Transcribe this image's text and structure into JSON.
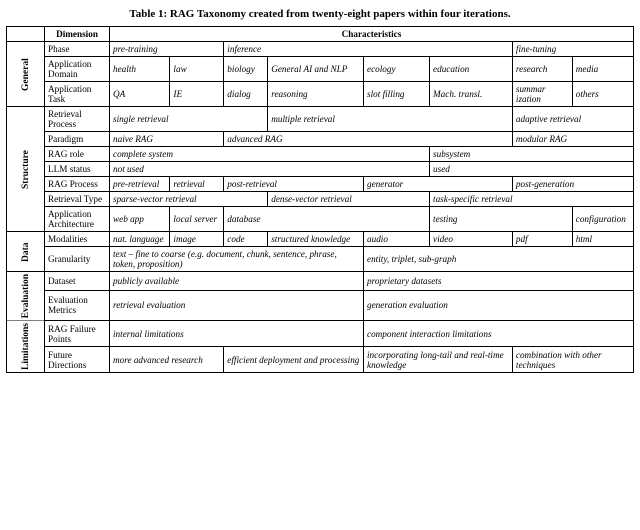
{
  "title": "Table 1: RAG Taxonomy created from twenty-eight papers within four iterations.",
  "header": {
    "dim_label": "Dimension",
    "char_label": "Characteristics"
  },
  "sections": [
    {
      "group": "General",
      "rows": [
        {
          "label": "Phase",
          "cells": [
            {
              "text": "pre-training",
              "italic": true,
              "colspan": 2
            },
            {
              "text": "inference",
              "italic": true,
              "colspan": 4
            },
            {
              "text": "fine-tuning",
              "italic": true,
              "colspan": 2
            }
          ]
        },
        {
          "label": "Application Domain",
          "cells": [
            {
              "text": "health",
              "italic": true
            },
            {
              "text": "law",
              "italic": true
            },
            {
              "text": "biology",
              "italic": true
            },
            {
              "text": "General AI and NLP",
              "italic": true
            },
            {
              "text": "ecology",
              "italic": true
            },
            {
              "text": "education",
              "italic": true
            },
            {
              "text": "research",
              "italic": true
            },
            {
              "text": "media",
              "italic": true
            }
          ]
        },
        {
          "label": "Application Task",
          "cells": [
            {
              "text": "QA",
              "italic": true
            },
            {
              "text": "IE",
              "italic": true
            },
            {
              "text": "dialog",
              "italic": true
            },
            {
              "text": "reasoning",
              "italic": true
            },
            {
              "text": "slot filling",
              "italic": true
            },
            {
              "text": "Mach. transl.",
              "italic": true
            },
            {
              "text": "summar ization",
              "italic": true
            },
            {
              "text": "others",
              "italic": true
            }
          ]
        }
      ]
    },
    {
      "group": "Structure",
      "rows": [
        {
          "label": "Retrieval Process",
          "cells": [
            {
              "text": "single retrieval",
              "italic": true,
              "colspan": 3
            },
            {
              "text": "multiple retrieval",
              "italic": true,
              "colspan": 3
            },
            {
              "text": "adaptive retrieval",
              "italic": true,
              "colspan": 2
            }
          ]
        },
        {
          "label": "Paradigm",
          "cells": [
            {
              "text": "naive RAG",
              "italic": true,
              "colspan": 2
            },
            {
              "text": "advanced RAG",
              "italic": true,
              "colspan": 4
            },
            {
              "text": "modular RAG",
              "italic": true,
              "colspan": 2
            }
          ]
        },
        {
          "label": "RAG role",
          "cells": [
            {
              "text": "complete system",
              "italic": true,
              "colspan": 5
            },
            {
              "text": "subsystem",
              "italic": true,
              "colspan": 3
            }
          ]
        },
        {
          "label": "LLM status",
          "cells": [
            {
              "text": "not used",
              "italic": true,
              "colspan": 5
            },
            {
              "text": "used",
              "italic": true,
              "colspan": 3
            }
          ]
        },
        {
          "label": "RAG Process",
          "cells": [
            {
              "text": "pre-retrieval",
              "italic": true
            },
            {
              "text": "retrieval",
              "italic": true
            },
            {
              "text": "post-retrieval",
              "italic": true,
              "colspan": 2
            },
            {
              "text": "generator",
              "italic": true,
              "colspan": 2
            },
            {
              "text": "post-generation",
              "italic": true,
              "colspan": 2
            }
          ]
        },
        {
          "label": "Retrieval Type",
          "cells": [
            {
              "text": "sparse-vector retrieval",
              "italic": true,
              "colspan": 3
            },
            {
              "text": "dense-vector retrieval",
              "italic": true,
              "colspan": 2
            },
            {
              "text": "task-specific retrieval",
              "italic": true,
              "colspan": 3
            }
          ]
        },
        {
          "label": "Application Architecture",
          "cells": [
            {
              "text": "web app",
              "italic": true
            },
            {
              "text": "local server",
              "italic": true
            },
            {
              "text": "database",
              "italic": true,
              "colspan": 3
            },
            {
              "text": "testing",
              "italic": true,
              "colspan": 2
            },
            {
              "text": "configuration",
              "italic": true
            }
          ]
        }
      ]
    },
    {
      "group": "Data",
      "rows": [
        {
          "label": "Modalities",
          "cells": [
            {
              "text": "nat. language",
              "italic": true
            },
            {
              "text": "image",
              "italic": true
            },
            {
              "text": "code",
              "italic": true
            },
            {
              "text": "structured knowledge",
              "italic": true
            },
            {
              "text": "audio",
              "italic": true
            },
            {
              "text": "video",
              "italic": true
            },
            {
              "text": "pdf",
              "italic": true
            },
            {
              "text": "html",
              "italic": true
            }
          ]
        },
        {
          "label": "Granularity",
          "cells": [
            {
              "text": "text – fine to coarse (e.g. document, chunk, sentence, phrase, token, proposition)",
              "italic": true,
              "colspan": 4
            },
            {
              "text": "entity, triplet, sub-graph",
              "italic": true,
              "colspan": 4
            }
          ]
        }
      ]
    },
    {
      "group": "Evaluation",
      "rows": [
        {
          "label": "Dataset",
          "cells": [
            {
              "text": "publicly available",
              "italic": true,
              "colspan": 4
            },
            {
              "text": "proprietary datasets",
              "italic": true,
              "colspan": 4
            }
          ]
        },
        {
          "label": "Evaluation Metrics",
          "cells": [
            {
              "text": "retrieval evaluation",
              "italic": true,
              "colspan": 4
            },
            {
              "text": "generation evaluation",
              "italic": true,
              "colspan": 4
            }
          ]
        }
      ]
    },
    {
      "group": "Limitations",
      "rows": [
        {
          "label": "RAG Failure Points",
          "cells": [
            {
              "text": "internal limitations",
              "italic": true,
              "colspan": 4
            },
            {
              "text": "component interaction limitations",
              "italic": true,
              "colspan": 4
            }
          ]
        },
        {
          "label": "Future Directions",
          "cells": [
            {
              "text": "more advanced research",
              "italic": true,
              "colspan": 2
            },
            {
              "text": "efficient deployment and processing",
              "italic": true,
              "colspan": 2
            },
            {
              "text": "incorporating long-tail and real-time knowledge",
              "italic": true,
              "colspan": 2
            },
            {
              "text": "combination with other techniques",
              "italic": true,
              "colspan": 2
            }
          ]
        }
      ]
    }
  ]
}
